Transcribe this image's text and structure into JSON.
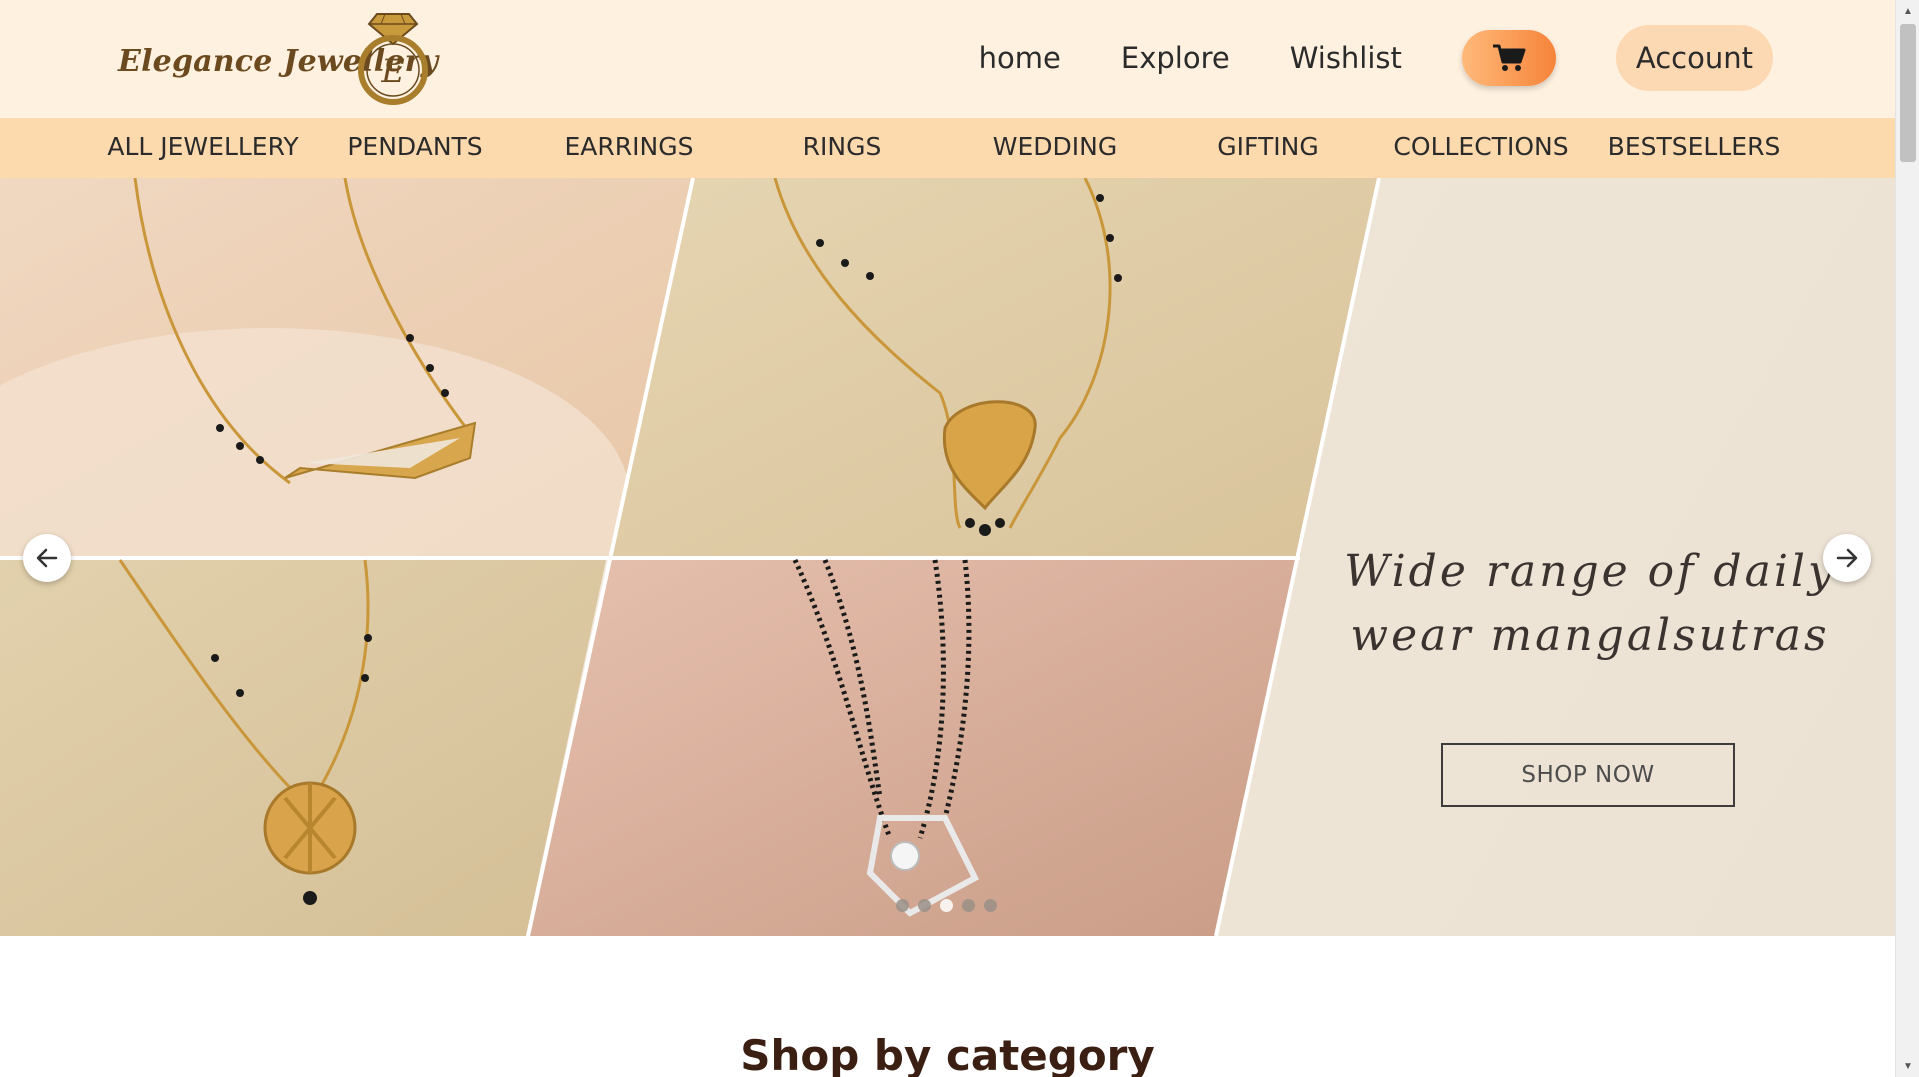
{
  "brand": {
    "name": "Elegance Jewellery",
    "monogram": "E",
    "colors": {
      "header_bg": "#fff1e0",
      "catbar_bg": "#fdd9ae",
      "accent": "#f6843a",
      "brand_text": "#6b4a1f"
    }
  },
  "nav": {
    "home": "home",
    "explore": "Explore",
    "wishlist": "Wishlist",
    "cart_icon": "cart-icon",
    "account": "Account"
  },
  "categories": [
    "ALL JEWELLERY",
    "PENDANTS",
    "EARRINGS",
    "RINGS",
    "WEDDING",
    "GIFTING",
    "COLLECTIONS",
    "BESTSELLERS"
  ],
  "hero": {
    "caption_line1": "Wide range of daily",
    "caption_line2": "wear mangalsutras",
    "cta": "SHOP NOW",
    "prev_icon": "arrow-left-icon",
    "next_icon": "arrow-right-icon",
    "slide_count": 5,
    "active_slide": 3
  },
  "section": {
    "title": "Shop by category"
  }
}
